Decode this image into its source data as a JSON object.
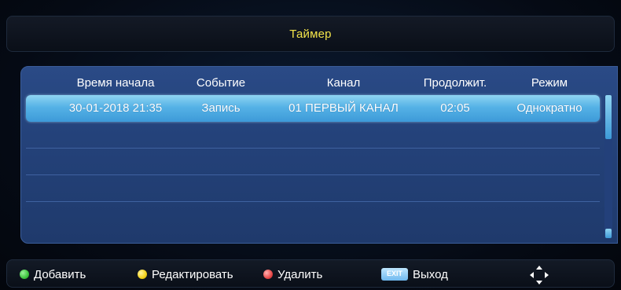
{
  "title": "Таймер",
  "columns": {
    "start_time": "Время начала",
    "event": "Событие",
    "channel": "Канал",
    "duration": "Продолжит.",
    "mode": "Режим"
  },
  "rows": [
    {
      "start_time": "30-01-2018 21:35",
      "event": "Запись",
      "channel": "01 ПЕРВЫЙ КАНАЛ",
      "duration": "02:05",
      "mode": "Однократно",
      "selected": true
    }
  ],
  "empty_row_count": 4,
  "bottom_bar": {
    "add_label": "Добавить",
    "edit_label": "Редактировать",
    "delete_label": "Удалить",
    "exit_key_label": "EXIT",
    "exit_label": "Выход",
    "nav_icon": "navigation-arrows-icon"
  },
  "colors": {
    "title_text": "#f2e34a",
    "add_dot": "#3ec43e",
    "edit_dot": "#f3d21a",
    "delete_dot": "#e84a4a",
    "selected_row": "#55b2e6",
    "panel": "#24427a"
  }
}
